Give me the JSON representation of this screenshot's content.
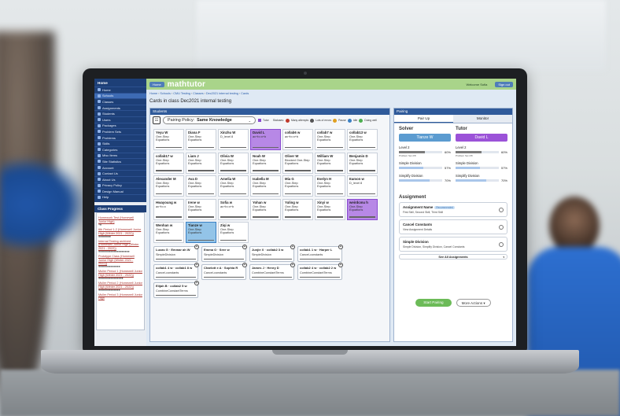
{
  "topbar": {
    "home": "Home",
    "brand": "mathtutor",
    "welcome": "Welcome Sofia",
    "signout": "Sign out"
  },
  "sidebar": {
    "heading": "Home",
    "items": [
      "Home",
      "Schools",
      "Classes",
      "Assignments",
      "Students",
      "Users",
      "Packages",
      "Problem Sets",
      "Problems",
      "Skills",
      "Categories",
      "Misc Items",
      "Site Statistics",
      "Account",
      "Contact Us",
      "About Us",
      "Privacy Policy",
      "Design Manual",
      "Help"
    ],
    "progress_heading": "Class Progress",
    "progress": [
      {
        "link": "Homework Test (Homewell Junior High)",
        "mark": "+●"
      },
      {
        "link": "6th Period 1-2 (Homewell Junior High (Winter 2021 - 2022))",
        "mark": "●●●●●●●●"
      },
      {
        "link": "Internal Testing archived (Homewell Junior High (Winter 2021 - 2022))",
        "mark": "●●●●●●●●●●●●●●●●●●●●"
      },
      {
        "link": "Prototype Class (Homewell Junior High (Winter 2021 - 2022))",
        "mark": "●●●●●●●●●●●●●●"
      },
      {
        "link": "Muller Period 1 (Homewell Junior High (Winter 2021 - 2022))",
        "mark": "●●●●●●●●●●●●●●●●"
      },
      {
        "link": "Muller Period 2 (Homewell Junior High (Winter 2021 - 2022))",
        "mark": "●●●●●●●●●●●●●●"
      },
      {
        "link": "Muller Period 3 (Homewell Junior High",
        "mark": ""
      }
    ]
  },
  "breadcrumbs": [
    "Home",
    "Schools",
    "CMU Testing",
    "Classes",
    "Dec2021 internal testing",
    "Cards"
  ],
  "page_title": "Cards in class Dec2021 internal testing",
  "students": {
    "heading": "Students",
    "policy_label": "Pairing Policy:",
    "policy_value": "Same Knowledge",
    "legend": {
      "tutor": "Tutor",
      "statuses": "Statuses:",
      "many": "Many attempts",
      "errors": "Lots of errors",
      "pause": "Pause",
      "idle": "Idle",
      "doing_well": "Doing well"
    },
    "cards": [
      {
        "name": "Yeyu W",
        "skill": "One-Step Equations",
        "style": ""
      },
      {
        "name": "Diana F",
        "skill": "One-Step Equations",
        "style": ""
      },
      {
        "name": "Xinzhu W",
        "skill": "D_level 8",
        "style": ""
      },
      {
        "name": "David L",
        "skill": "ax+b=x+b",
        "style": "purple"
      },
      {
        "name": "collab6 w",
        "skill": "ax+b=x+b",
        "style": ""
      },
      {
        "name": "collab7 w",
        "skill": "One-Step Equations",
        "style": ""
      },
      {
        "name": "collab13 w",
        "skill": "One-Step Equations",
        "style": ""
      },
      {
        "name": "collab17 w",
        "skill": "One-Step Equations",
        "style": ""
      },
      {
        "name": "Liam J",
        "skill": "One-Step Equations",
        "style": ""
      },
      {
        "name": "Olivia W",
        "skill": "One-Step Equations",
        "style": ""
      },
      {
        "name": "Noah W",
        "skill": "One-Step Equations",
        "style": ""
      },
      {
        "name": "Oliver W",
        "skill": "Blocked One-Step Equations",
        "style": ""
      },
      {
        "name": "William W",
        "skill": "One-Step Equations",
        "style": ""
      },
      {
        "name": "Benjamin D",
        "skill": "One-Step Equations",
        "style": ""
      },
      {
        "name": "Alexander M",
        "skill": "One-Step Equations",
        "style": ""
      },
      {
        "name": "Ava D",
        "skill": "One-Step Equations",
        "style": ""
      },
      {
        "name": "Amelia W",
        "skill": "One-Step Equations",
        "style": ""
      },
      {
        "name": "Isabella M",
        "skill": "One-Step Equations",
        "style": ""
      },
      {
        "name": "Mia G",
        "skill": "One-Step Equations",
        "style": ""
      },
      {
        "name": "Evelyn H",
        "skill": "One-Step Equations",
        "style": ""
      },
      {
        "name": "Eamon w",
        "skill": "D_level 8",
        "style": ""
      },
      {
        "name": "Hwayoung w",
        "skill": "ax+b=x",
        "style": ""
      },
      {
        "name": "Irene w",
        "skill": "One-Step Equations",
        "style": ""
      },
      {
        "name": "Sofia w",
        "skill": "ax+b=x+b",
        "style": ""
      },
      {
        "name": "Yohan w",
        "skill": "One-Step Equations",
        "style": ""
      },
      {
        "name": "Yuling w",
        "skill": "One-Step Equations",
        "style": ""
      },
      {
        "name": "Xinyi w",
        "skill": "One-Step Equations",
        "style": ""
      },
      {
        "name": "weirdcmu h",
        "skill": "One-Step Equations",
        "style": "purple"
      },
      {
        "name": "Wenhan w",
        "skill": "One-Step Equations",
        "style": ""
      },
      {
        "name": "Tianze w",
        "skill": "One-Step Equations",
        "style": "blue"
      },
      {
        "name": "Ziqi w",
        "skill": "One-Step Equations",
        "style": ""
      }
    ],
    "groups": [
      {
        "members": "Lucas G · Emmar ah W",
        "skill": "SimpleDivision"
      },
      {
        "members": "Emma O · Sree w",
        "skill": "SimpleDivision"
      },
      {
        "members": "Junjie X · collab2 3 w",
        "skill": "SimpleDivision"
      },
      {
        "members": "collab1 1 w · Harper L",
        "skill": "Cancel-constants"
      },
      {
        "members": "collab1 4 w · collab1 8 w",
        "skill": "Cancel-constants"
      },
      {
        "members": "Charlott e A · Sophia R",
        "skill": "Cancel-constants"
      },
      {
        "members": "James J · Henry D",
        "skill": "CombineConstantTerms"
      },
      {
        "members": "collab2 4 w · collab2 2 w",
        "skill": "CombineConstantTerms"
      },
      {
        "members": "Elijah B · collab2 5 w",
        "skill": "CombineConstantTerms"
      }
    ]
  },
  "pairing": {
    "heading": "Pairing",
    "tabs": [
      "Pair Up",
      "Monitor"
    ],
    "solver": {
      "heading": "Solver",
      "name": "Tianze W",
      "color": "#5b9bd0",
      "level": "Level 2",
      "level_pct": 60,
      "problem_set": "Problem Set 2/8",
      "skills": [
        {
          "name": "Simple Division",
          "pct": 57
        },
        {
          "name": "Simplify Division",
          "pct": 70
        }
      ]
    },
    "tutor": {
      "heading": "Tutor",
      "name": "David L",
      "color": "#9b52d8",
      "level": "Level 2",
      "level_pct": 60,
      "problem_set": "Problem Set 2/8",
      "skills": [
        {
          "name": "Simple Division",
          "pct": 57
        },
        {
          "name": "Simplify Division",
          "pct": 70
        }
      ]
    },
    "assignment_heading": "Assignment",
    "assignments": [
      {
        "title": "Assignment Name",
        "badge": "Recommended",
        "desc": "First Skill, Second Skill, Third Skill"
      },
      {
        "title": "Cancel Constants",
        "badge": "",
        "desc": "View Assignment Details"
      },
      {
        "title": "Simple Division",
        "badge": "",
        "desc": "Simple Division, Simplify Division, Cancel Constants"
      }
    ],
    "see_all": "See All Assignments",
    "start": "Start Pairing",
    "more": "More Actions"
  }
}
